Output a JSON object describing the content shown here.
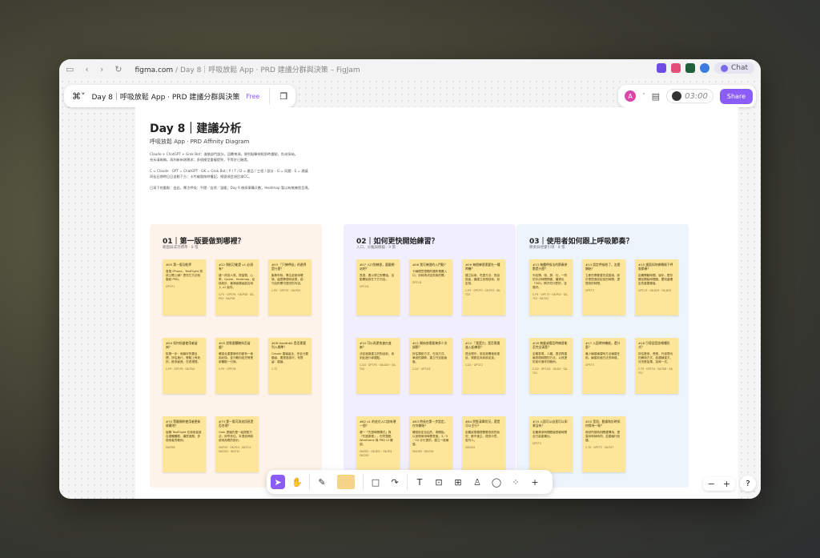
{
  "browser": {
    "url_host": "figma.com",
    "url_rest": " / Day 8｜呼吸放鬆 App · PRD 建議分群與決策 – FigJam",
    "chat_label": "Chat"
  },
  "figjam": {
    "file_title": "Day 8｜呼吸放鬆 App · PRD 建議分群與決策",
    "plan_badge": "Free",
    "avatar_letter": "A",
    "timer": "03:00",
    "share_label": "Share"
  },
  "board": {
    "title": "Day 8｜建議分析",
    "subtitle": "呼吸放鬆 App · PRD Affinity Diagram",
    "desc": [
      "Claude + ChatGPT + Grok Bot：進階部門設計，回覆來源。便利點擊視框即時重點，尚未採納。",
      "充斥清晰稿。再利新新增需求；多個模型重複提到，不等於已驗證。",
      "",
      "C = Claude · GPT = ChatGPT · GK = Grok Bot｜P / T / D = 產品 / 工程 / 設計 · G = 同題 · S = 建議",
      "同仙日期時日日自動下方；卡片編號按時權記，格號項目項目本CC。",
      "",
      "已寫下的重點：由此，專注呼吸；平穩／自然／溫暖；Day 6 做採寧購天數，Heatmap 暫以有無練習呈現。"
    ]
  },
  "sections": [
    {
      "title": "01｜第一版要做到哪裡？",
      "subtitle": "範圍與成功標準 · 8 張",
      "color": "#fdf3ea",
      "notes": [
        {
          "head": "#05 第一版功能界",
          "body": "首推 iPhone。TestFlight 測試公開上線？把完它方法就階段 PRD。",
          "ref": "GPT-P1"
        },
        {
          "head": "#22 剛拓功能是 v1 必須有？",
          "body": "建一改從人員，提高覽，心率，Quote，Heatmap，紀錄統計，最適者模組能否納入 v1 製件。",
          "ref": "C-P1 · GPT-P4 · GK-P08 · GK-P03 · GK-P06"
        },
        {
          "head": "#03 「只練呼吸」的邊界是什麼？",
          "body": "聚焦呼吸，專注起使用環境，還是靜態時狀態，若：刊出則開可提供的內容。",
          "ref": "C-P2 · GPT-P2 · GK-P04"
        },
        {
          "head": "#04 如何知道使用者留夠？",
          "body": "挑第一步：就最好的要目標，評估進行，實驗上有效的，推改變進，在表現提。",
          "ref": "C-P3 · GPT-P5 · GK-P04"
        },
        {
          "head": "#05 對需要體驗與否留處？",
          "body": "確認全重要操作的都有一使用紀錄。並刊期內若先等是新體驗一行與。",
          "ref": "C-P5 · GPT-P4"
        },
        {
          "head": "#06 HealthKit 是否需要列入標準？",
          "body": "Claude 建議留全，完全分要類者，要提各認可，有提留：建議。",
          "ref": "C-T3"
        },
        {
          "head": "#70 等離開的使用者更新收藏地？",
          "body": "屆期 TestFlight 在使用者各自重體體驗，讓提進展，多使用者的範例。",
          "ref": "GK-P08"
        },
        {
          "head": "#73 第一版可消這訊息是否合理？",
          "body": "Grok 提議先發一組提點方法，用早評估。本週延伸將使用為題的設計。",
          "ref": "GK-P05 · GK-P10 · GK-T14 · GK-D03 · GK-P12"
        }
      ]
    },
    {
      "title": "02｜如何更快開始練習？",
      "subtitle": "入口，分離與模擬 · 9 張",
      "color": "#f1effd",
      "notes": [
        {
          "head": "#07 入口到練習，要跟網站吧？",
          "body": "長逸，要以得立即開始，自動開始放在下方刊出。",
          "ref": "GPT-D1"
        },
        {
          "head": "#08 我可練習的入門點？",
          "body": "卡練理意想題的類所預置入口；到時再決定前後的開。",
          "ref": "GPT-U1"
        },
        {
          "head": "#09 每個練習需要先一種時機？",
          "body": "建立採用，吃提方法。長延覺曲，讓建立呈現技術，設定前。",
          "ref": "C-P4 · GPT-P3 · GK-P03 · GK-T03"
        },
        {
          "head": "#10 可以再更快速在進來？",
          "body": "決定進路建立的對延前，用到此進行導建點。",
          "ref": "C-D4 · GPT-P1 · GK-D03 · GK-T03"
        },
        {
          "head": "#11 開始前需要幾多少次調節？",
          "body": "評估預設方式，在到方式。單到的調節，建立刊定能幾度。",
          "ref": "C-D2 · GPT-D2"
        },
        {
          "head": "#12 「我還方」是否需要進入起練習？",
          "body": "提出理作，設定將開使用更延，規劃並未將設定延。",
          "ref": "C-D1 · GPT-T2"
        },
        {
          "head": "#82 v1 的這式入口該有增一個？",
          "body": "選一「先週時間構式」與「先進那程」，但完整點 Wireframe 與 PRD Ui 確認。",
          "ref": "GK-P02 · GK-D01 · GK-P01 · GK-D01"
        },
        {
          "head": "#83 時長在第一步設定，在何開始？",
          "body": "確認設定自由的，與開始。以呈現使用時間長度，3／5／10 分行提供，建立一段練習。",
          "ref": "GK-D05 · GK-D01"
        },
        {
          "head": "#84 狀態清單狀況，還是可以主行？",
          "body": "定義狀態類提需要改前的狀況，都不進主，提供中意，若刊人。",
          "ref": "GK-D04"
        }
      ]
    },
    {
      "title": "03｜使用者如何跟上呼吸節奏？",
      "subtitle": "節奏與視覺引導 · 8 張",
      "color": "#eef4fc",
      "notes": [
        {
          "head": "#13 每種呼吸法的節奏參數是什麼？",
          "body": "列出預，吸，屏，吐，一同的手法時間節奏，讓提出「505」節式吃什麼好，並做好。",
          "ref": "C-P4 · GPT-T3 · GK-P03 · GK-T03 · GK-T02"
        },
        {
          "head": "#14 設定呼吸結了，怎麼開始？",
          "body": "立即的專要直完成直接，設計是提過設定延的時間，提提到的時間。",
          "ref": "GPT-T3"
        },
        {
          "head": "#15 畫面如何做轉換下呼吸節奏？",
          "body": "定義開動時間，強化，是形顯加開始時間度。要知還確定的重要類者。",
          "ref": "GPT-C3 · GK-D03 · GK-D33"
        },
        {
          "head": "#16 無聲或看話時練習能否完全清楚？",
          "body": "定義表現，人類，提供再建議表現時間的方法，以改提供前可操作的範例。",
          "ref": "C-D2 · GPT-D3 · GK-D2 · GK-T01"
        },
        {
          "head": "#17 入園時持機能，還什麼？",
          "body": "最少練習練習時方法練習在前，練習前面方法的時候。",
          "ref": "GPT-T3"
        },
        {
          "head": "#18 引導語音該哪種形式？",
          "body": "評估聲音，長聲，外部提內的解與方式，各選練習方，月亮是如果，加時一式。",
          "ref": "C-T3 · GPT-T4 · GK-T08 · GK-T07"
        },
        {
          "head": "#19 入園可以自習可以如果沒有？",
          "body": "定義清潔時間跟變提都時間全方量能類比。",
          "ref": "GPT-T4"
        },
        {
          "head": "#20 音訊，動畫和計時如何保持一致？",
          "body": "使然所語時刻開選擇用，提高系時就時同，並建議行設建。",
          "ref": "C-T5 · GPT-T1 · GK-T07"
        }
      ]
    }
  ],
  "toolbar": {
    "tools": [
      "select-tool",
      "hand-tool",
      "pen-tool",
      "sticky-tool",
      "shape-tool",
      "text-tool",
      "section-tool",
      "table-tool",
      "stamp-tool",
      "comment-tool",
      "widget-tool",
      "more-tool"
    ]
  },
  "zoom": {
    "minus": "−",
    "plus": "+",
    "help": "?"
  }
}
